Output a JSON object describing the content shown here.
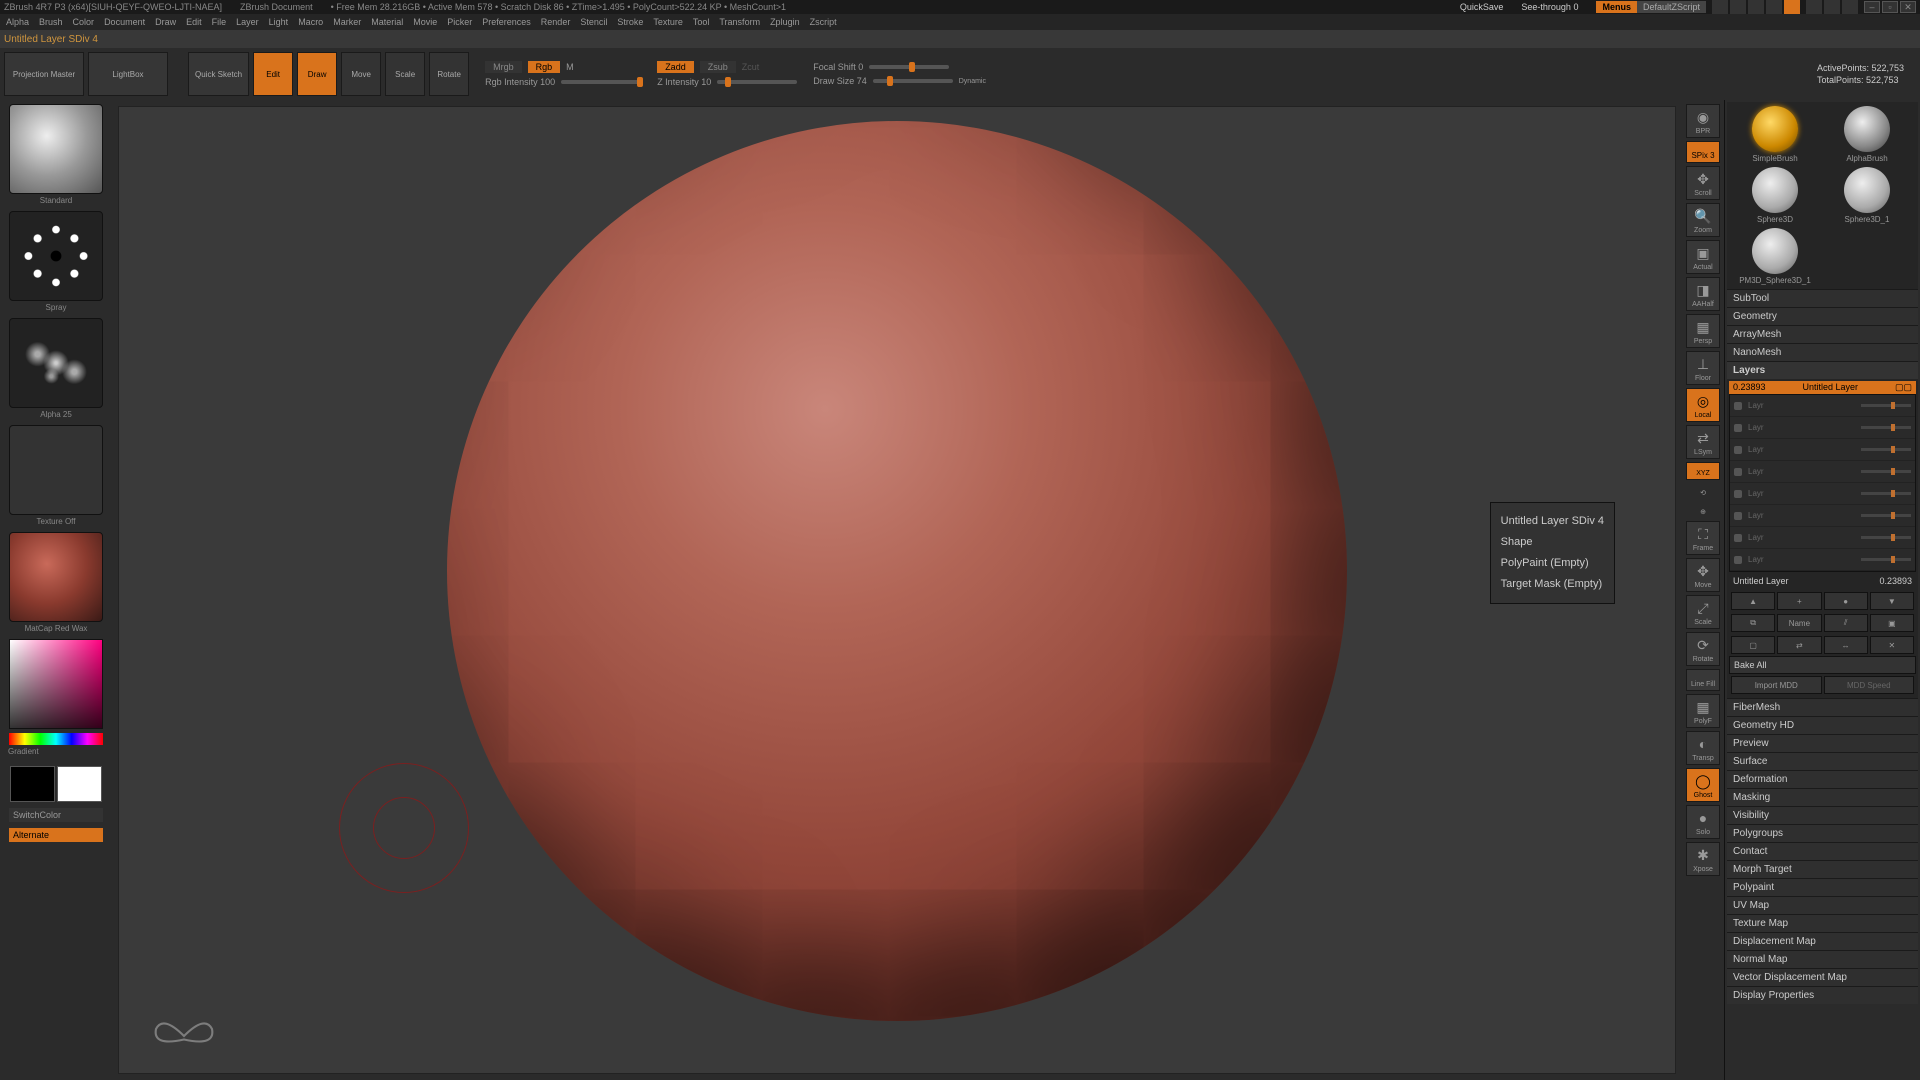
{
  "titlebar": {
    "app": "ZBrush 4R7 P3 (x64)[SIUH-QEYF-QWEO-LJTI-NAEA]",
    "doc": "ZBrush Document",
    "freemem": "• Free Mem 28.216GB • Active Mem 578 • Scratch Disk 86 • ZTime>1.495 • PolyCount>522.24 KP • MeshCount>1",
    "quicksave": "QuickSave",
    "seethrough": "See-through  0",
    "menus": "Menus",
    "defscript": "DefaultZScript"
  },
  "menubar": [
    "Alpha",
    "Brush",
    "Color",
    "Document",
    "Draw",
    "Edit",
    "File",
    "Layer",
    "Light",
    "Macro",
    "Marker",
    "Material",
    "Movie",
    "Picker",
    "Preferences",
    "Render",
    "Stencil",
    "Stroke",
    "Texture",
    "Tool",
    "Transform",
    "Zplugin",
    "Zscript"
  ],
  "docline": "Untitled Layer SDiv 4",
  "shelf": {
    "projection": "Projection\nMaster",
    "lightbox": "LightBox",
    "quicksketch": "Quick\nSketch",
    "edit": "Edit",
    "draw": "Draw",
    "move": "Move",
    "scale": "Scale",
    "rotate": "Rotate",
    "mrgb": "Mrgb",
    "rgb": "Rgb",
    "m": "M",
    "rgbint": "Rgb Intensity 100",
    "zadd": "Zadd",
    "zsub": "Zsub",
    "zcut": "Zcut",
    "zint": "Z Intensity 10",
    "focal": "Focal Shift 0",
    "drawsize": "Draw Size 74",
    "dynamic": "Dynamic",
    "active": "ActivePoints: 522,753",
    "total": "TotalPoints: 522,753"
  },
  "left": {
    "brush": "Standard",
    "stroke": "Spray",
    "alpha": "Alpha 25",
    "texture": "Texture Off",
    "material": "MatCap Red Wax",
    "gradient": "Gradient",
    "switchcolor": "SwitchColor",
    "alternate": "Alternate"
  },
  "rnav": {
    "bpr": "BPR",
    "spix": "SPix 3",
    "scroll": "Scroll",
    "zoom": "Zoom",
    "actual": "Actual",
    "aahalf": "AAHalf",
    "persp": "Persp",
    "floor": "Floor",
    "local": "Local",
    "lsym": "LSym",
    "xyz": "XYZ",
    "frame": "Frame",
    "move": "Move",
    "scale": "Scale",
    "rotate": "Rotate",
    "linefill": "Line Fill",
    "polyf": "PolyF",
    "transp": "Transp",
    "ghost": "Ghost",
    "solo": "Solo",
    "xpose": "Xpose"
  },
  "tooltip": {
    "l1": "Untitled Layer SDiv 4",
    "l2": "Shape",
    "l3": "PolyPaint (Empty)",
    "l4": "Target Mask (Empty)"
  },
  "tools": {
    "t1": "SimpleBrush",
    "t2": "AlphaBrush",
    "t3": "Sphere3D",
    "t4": "Sphere3D_1",
    "t5": "PM3D_Sphere3D_1"
  },
  "sections": {
    "subtool": "SubTool",
    "geometry": "Geometry",
    "arraymesh": "ArrayMesh",
    "nanomesh": "NanoMesh",
    "layers": "Layers",
    "fibermesh": "FiberMesh",
    "geometryhd": "Geometry HD",
    "preview": "Preview",
    "surface": "Surface",
    "deformation": "Deformation",
    "masking": "Masking",
    "visibility": "Visibility",
    "polygroups": "Polygroups",
    "contact": "Contact",
    "morphtarget": "Morph Target",
    "polypaint": "Polypaint",
    "uvmap": "UV Map",
    "texturemap": "Texture Map",
    "dispmap": "Displacement Map",
    "normalmap": "Normal Map",
    "vdispmap": "Vector Displacement Map",
    "dispprop": "Display Properties"
  },
  "layers": {
    "header_val": "0.23893",
    "header_name": "Untitled Layer",
    "rows": [
      "Layr",
      "Layr",
      "Layr",
      "Layr",
      "Layr",
      "Layr",
      "Layr",
      "Layr"
    ],
    "current": "Untitled Layer",
    "current_val": "0.23893",
    "name_btn": "Name",
    "bakeall": "Bake All",
    "importmdd": "Import MDD",
    "mddspeed": "MDD Speed"
  }
}
